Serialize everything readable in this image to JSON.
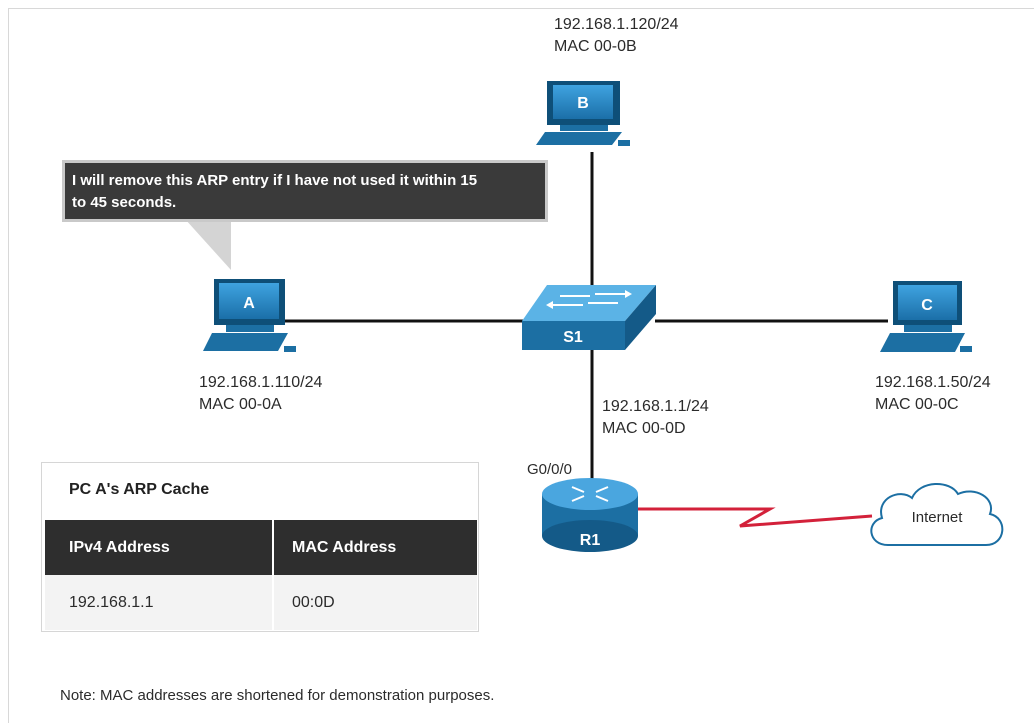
{
  "callout": {
    "text_line1": "I will remove this ARP entry if I have not used it within 15",
    "text_line2": "to 45 seconds."
  },
  "devices": {
    "pc_a": {
      "letter": "A",
      "ip": "192.168.1.110/24",
      "mac": "MAC 00-0A"
    },
    "pc_b": {
      "letter": "B",
      "ip": "192.168.1.120/24",
      "mac": "MAC 00-0B"
    },
    "pc_c": {
      "letter": "C",
      "ip": "192.168.1.50/24",
      "mac": "MAC 00-0C"
    },
    "switch": {
      "name": "S1"
    },
    "router": {
      "name": "R1",
      "interface": "G0/0/0",
      "ip": "192.168.1.1/24",
      "mac": "MAC 00-0D"
    },
    "cloud": {
      "label": "Internet"
    }
  },
  "arp_cache": {
    "title": "PC A's ARP Cache",
    "headers": [
      "IPv4 Address",
      "MAC Address"
    ],
    "rows": [
      [
        "192.168.1.1",
        "00:0D"
      ]
    ]
  },
  "note": "Note: MAC addresses are shortened for demonstration purposes.",
  "colors": {
    "device_blue": "#1c6fa3",
    "device_dark": "#0e4f78",
    "wan_link": "#d3213a",
    "callout_bg": "#3a3a3a"
  }
}
